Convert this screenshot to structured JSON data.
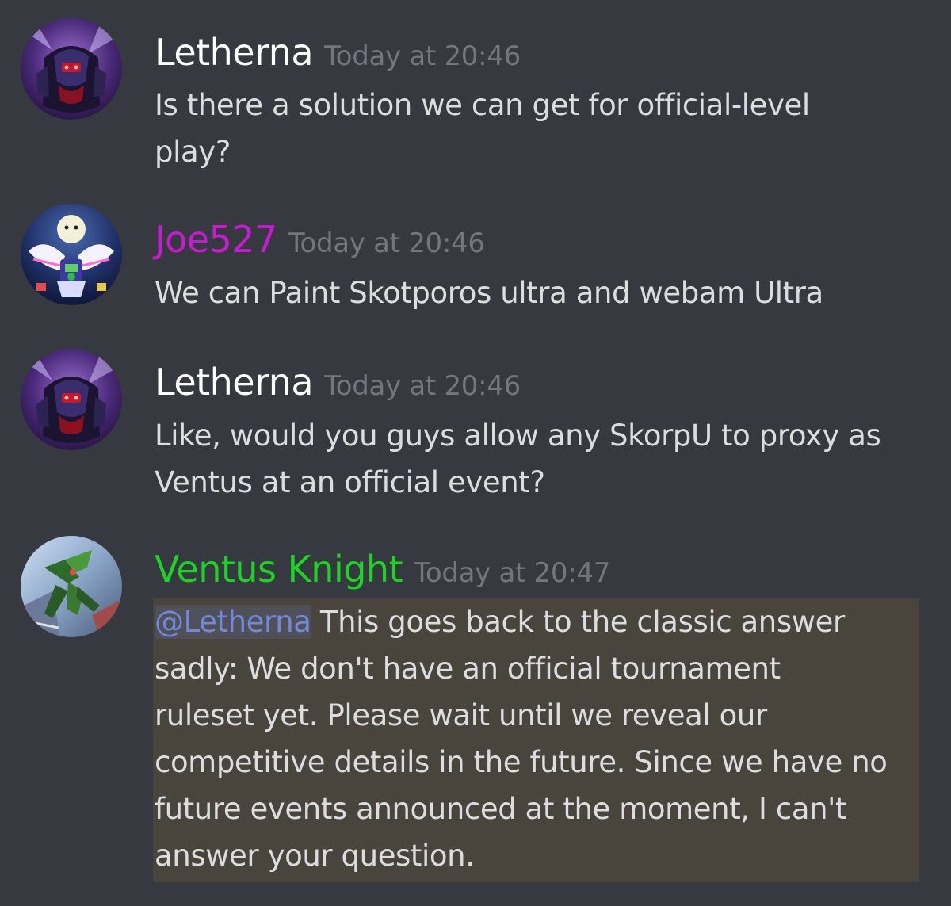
{
  "colors": {
    "background": "#36393f",
    "text": "#dcddde",
    "timestamp": "#72767d",
    "mention": "#7289da",
    "highlight_bg": "#49443c"
  },
  "messages": [
    {
      "username": "Letherna",
      "username_color": "#ffffff",
      "timestamp": "Today at 20:46",
      "avatar_icon": "dark-armored-robot-avatar",
      "lines": [
        "Is there a solution we can get for official-level",
        "play?"
      ]
    },
    {
      "username": "Joe527",
      "username_color": "#c61ccf",
      "timestamp": "Today at 20:46",
      "avatar_icon": "winged-knight-moon-avatar",
      "lines": [
        "We can Paint Skotporos ultra and webam Ultra"
      ]
    },
    {
      "username": "Letherna",
      "username_color": "#ffffff",
      "timestamp": "Today at 20:46",
      "avatar_icon": "dark-armored-robot-avatar",
      "lines": [
        "Like, would you guys allow any SkorpU to proxy as",
        "Ventus at an official event?"
      ]
    },
    {
      "username": "Ventus Knight",
      "username_color": "#1ed325",
      "timestamp": "Today at 20:47",
      "avatar_icon": "green-mech-avatar",
      "mention": "@Letherna",
      "first_line_rest": " This goes back to the classic answer",
      "lines": [
        "sadly: We don't have an official tournament",
        "ruleset yet. Please wait until we reveal our",
        "competitive details in the future. Since we have no",
        "future events announced at the moment, I can't",
        "answer your question."
      ]
    }
  ]
}
